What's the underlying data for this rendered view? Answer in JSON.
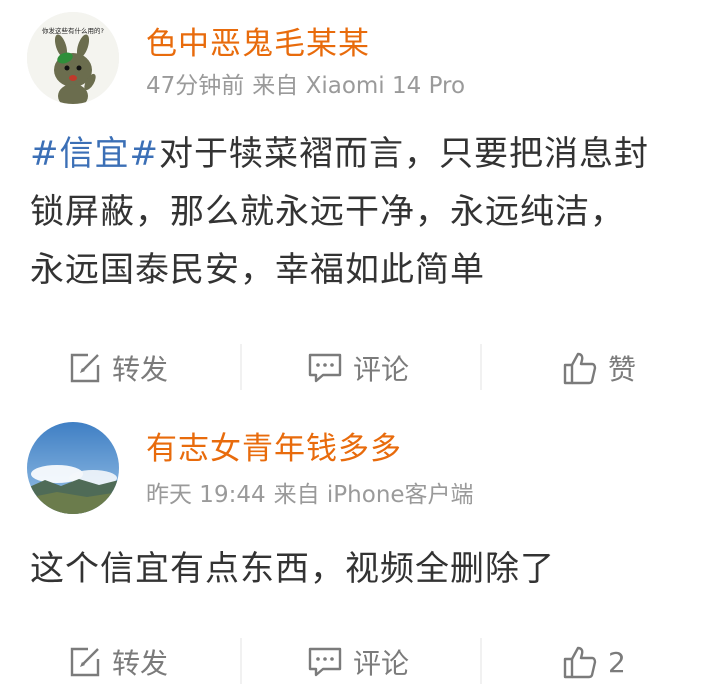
{
  "posts": [
    {
      "username": "色中恶鬼毛某某",
      "avatar_caption": "你发这些有什么用的?",
      "time": "47分钟前",
      "source": "来自 Xiaomi 14 Pro",
      "content": {
        "tag": "#信宜#",
        "line1_rest": "对于犊菜褶而言，只要把消息封",
        "line2": "锁屏蔽，那么就永远干净，永远纯洁，",
        "line3": "永远国泰民安，幸福如此简单"
      },
      "actions": {
        "repost_label": "转发",
        "comment_label": "评论",
        "like_label": "赞"
      }
    },
    {
      "username": "有志女青年钱多多",
      "time": "昨天 19:44",
      "source": "来自 iPhone客户端",
      "content": {
        "text": "这个信宜有点东西，视频全删除了"
      },
      "actions": {
        "repost_label": "转发",
        "comment_label": "评论",
        "like_count": "2"
      }
    }
  ],
  "colors": {
    "username": "#e86b0c",
    "tag": "#3b6fb6",
    "meta": "#9a9a9a",
    "action": "#7b7b7b",
    "content": "#333333"
  },
  "icons": {
    "repost": "edit-square-icon",
    "comment": "speech-bubble-icon",
    "like": "thumbs-up-icon"
  }
}
